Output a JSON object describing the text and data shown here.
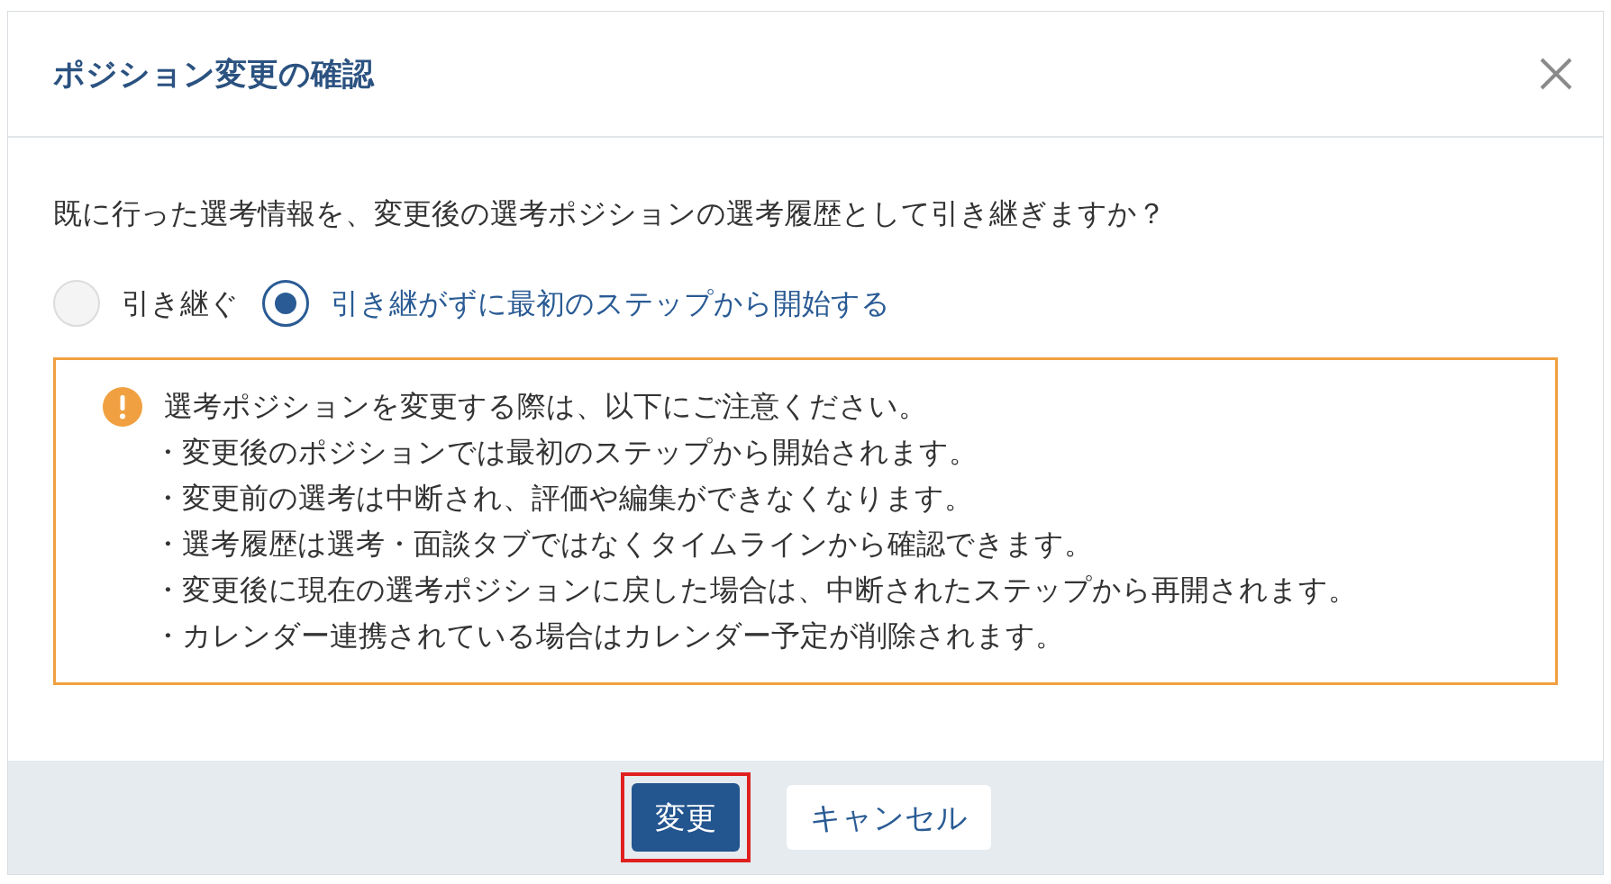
{
  "dialog": {
    "title": "ポジション変更の確認",
    "question": "既に行った選考情報を、変更後の選考ポジションの選考履歴として引き継ぎますか？",
    "options": [
      {
        "label": "引き継ぐ",
        "selected": false
      },
      {
        "label": "引き継がずに最初のステップから開始する",
        "selected": true
      }
    ],
    "notice": {
      "lines": [
        "選考ポジションを変更する際は、以下にご注意ください。",
        "・変更後のポジションでは最初のステップから開始されます。",
        "・変更前の選考は中断され、評価や編集ができなくなります。",
        "・選考履歴は選考・面談タブではなくタイムラインから確認できます。",
        "・変更後に現在の選考ポジションに戻した場合は、中断されたステップから再開されます。",
        "・カレンダー連携されている場合はカレンダー予定が削除されます。"
      ]
    },
    "buttons": [
      {
        "label": "変更",
        "kind": "primary",
        "highlighted": true
      },
      {
        "label": "キャンセル",
        "kind": "secondary",
        "highlighted": false
      }
    ]
  }
}
